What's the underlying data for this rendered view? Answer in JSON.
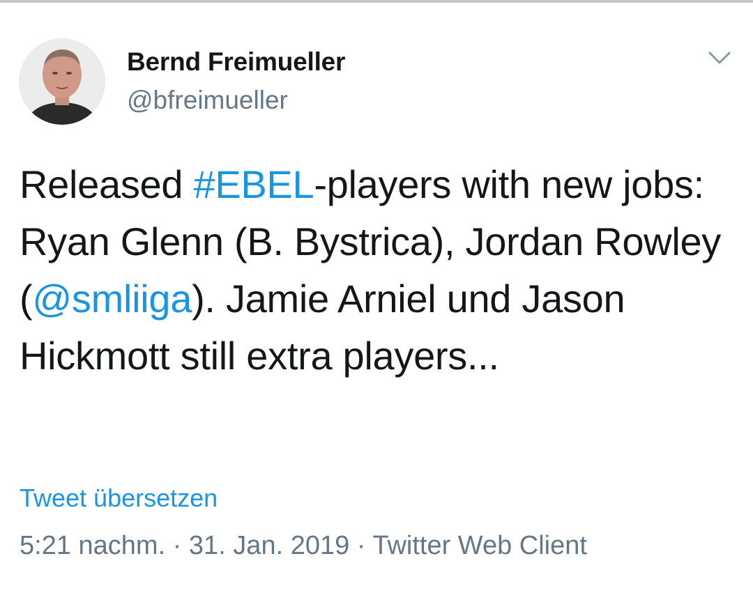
{
  "tweet": {
    "author": {
      "display_name": "Bernd Freimueller",
      "handle": "@bfreimueller",
      "avatar_icon": "user-avatar-photo"
    },
    "menu_icon": "chevron-down-icon",
    "text": {
      "part1": "Released ",
      "hashtag": "#EBEL",
      "part2": "-players with new jobs: Ryan Glenn (B. Bystrica), Jordan Rowley (",
      "mention": "@smliiga",
      "part3": "). Jamie Arniel und Jason Hickmott still extra players..."
    },
    "translate_label": "Tweet übersetzen",
    "meta": {
      "time": "5:21 nachm.",
      "separator1": " · ",
      "date": "31. Jan. 2019",
      "separator2": " · ",
      "client": "Twitter Web Client"
    }
  },
  "colors": {
    "link": "#1b95e0",
    "secondary_text": "#657786",
    "primary_text": "#14171a"
  }
}
